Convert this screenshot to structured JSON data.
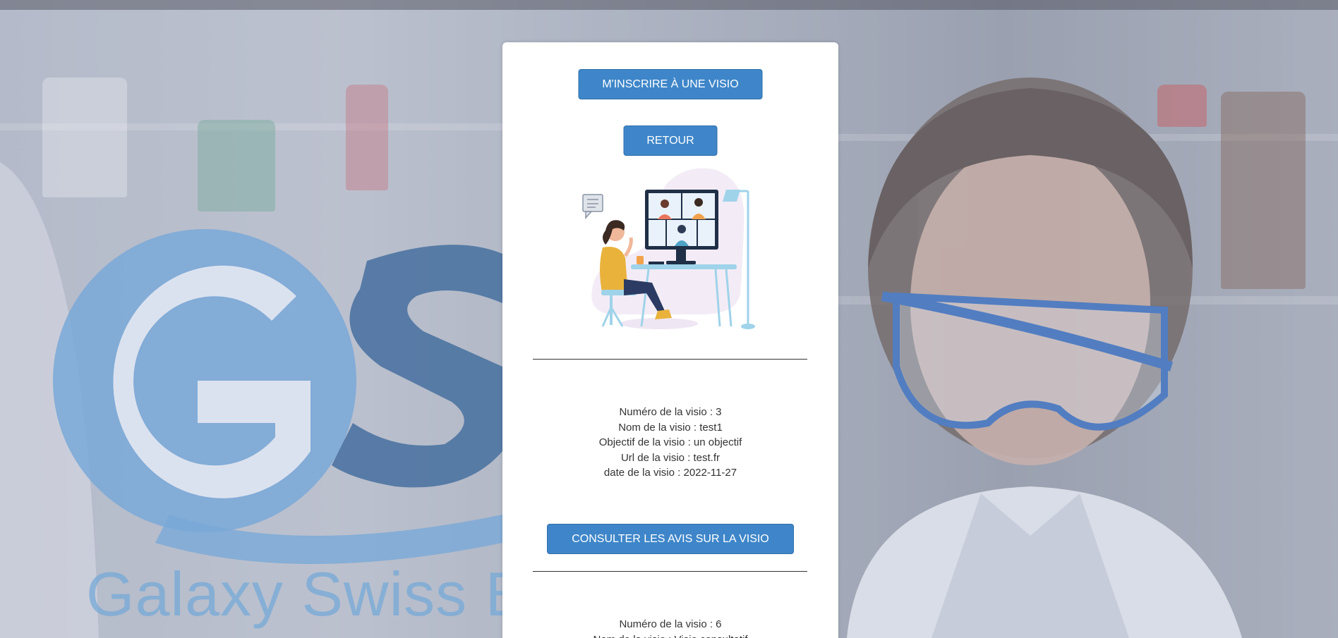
{
  "background": {
    "logo_letters": "GS",
    "logo_tagline": "Galaxy Swiss Bo"
  },
  "actions": {
    "register_label": "M'INSCRIRE À UNE VISIO",
    "back_label": "RETOUR",
    "reviews_label": "CONSULTER LES AVIS SUR LA VISIO"
  },
  "visios": [
    {
      "numero": "Numéro de la visio : 3",
      "nom": "Nom de la visio : test1",
      "objectif": "Objectif de la visio : un objectif",
      "url": "Url de la visio : test.fr",
      "date": "date de la visio : 2022-11-27"
    },
    {
      "numero": "Numéro de la visio : 6",
      "nom": "Nom de la visio : Visio consultatif"
    }
  ],
  "colors": {
    "button": "#3e86c9",
    "logo_light": "#5b9fd6",
    "logo_dark": "#24568d"
  },
  "icons": {
    "illustration": "video-call-illustration"
  }
}
